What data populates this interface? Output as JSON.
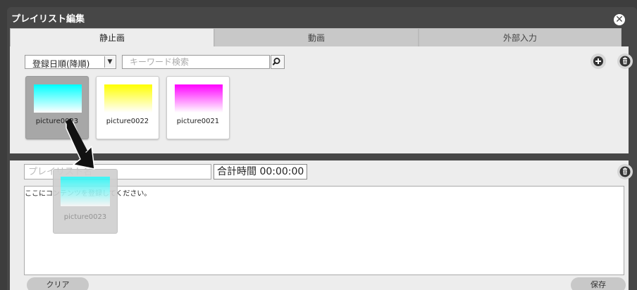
{
  "window": {
    "title": "プレイリスト編集"
  },
  "tabs": [
    {
      "label": "静止画",
      "active": true
    },
    {
      "label": "動画",
      "active": false
    },
    {
      "label": "外部入力",
      "active": false
    }
  ],
  "toolbar": {
    "sort_selected": "登録日順(降順)",
    "search_placeholder": "キーワード検索"
  },
  "library": {
    "items": [
      {
        "label": "picture0023",
        "color": "#00ffff",
        "selected": true
      },
      {
        "label": "picture0022",
        "color": "#ffff00",
        "selected": false
      },
      {
        "label": "picture0021",
        "color": "#ff00ff",
        "selected": false
      }
    ]
  },
  "playlist": {
    "name_placeholder": "プレイリスト名",
    "total_time": "合計時間 00:00:00",
    "empty_hint": "ここにコンテンツを登録してください。",
    "clear_label": "クリア",
    "save_label": "保存"
  },
  "drag": {
    "label": "picture0023",
    "color": "#00ffff"
  },
  "colors": {
    "window_bg": "#474747",
    "panel_bg": "#ededed",
    "active_tab": "#ededed",
    "inactive_tab": "#c8c8c8"
  }
}
